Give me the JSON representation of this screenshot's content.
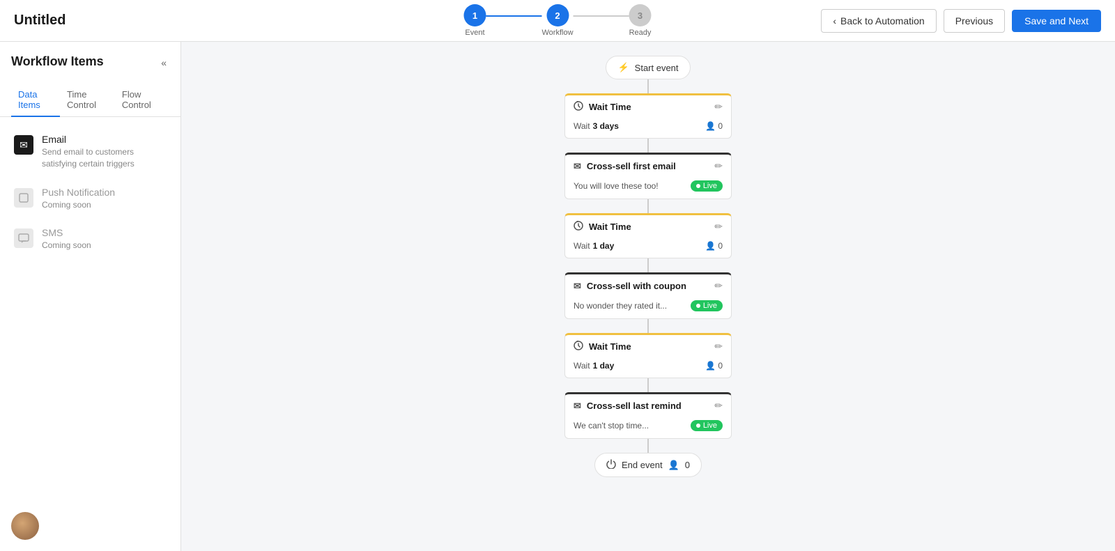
{
  "header": {
    "title": "Untitled",
    "back_button": "Back to Automation",
    "prev_button": "Previous",
    "save_button": "Save and Next"
  },
  "stepper": {
    "steps": [
      {
        "number": "1",
        "label": "Event",
        "state": "active"
      },
      {
        "number": "2",
        "label": "Workflow",
        "state": "active"
      },
      {
        "number": "3",
        "label": "Ready",
        "state": "inactive"
      }
    ]
  },
  "sidebar": {
    "title": "Workflow Items",
    "collapse_icon": "«",
    "tabs": [
      {
        "label": "Data Items",
        "active": true
      },
      {
        "label": "Time Control",
        "active": false
      },
      {
        "label": "Flow Control",
        "active": false
      }
    ],
    "items": [
      {
        "name": "Email",
        "desc": "Send email to customers satisfying certain triggers",
        "icon_type": "email",
        "icon_char": "✉",
        "muted": false
      },
      {
        "name": "Push Notification",
        "desc": "Coming soon",
        "icon_type": "push",
        "icon_char": "□",
        "muted": true
      },
      {
        "name": "SMS",
        "desc": "Coming soon",
        "icon_type": "sms",
        "icon_char": "💬",
        "muted": true
      }
    ]
  },
  "workflow": {
    "start_label": "Start event",
    "start_icon": "⚡",
    "end_label": "End event",
    "end_icon": "⏻",
    "end_count": "0",
    "nodes": [
      {
        "type": "wait",
        "title": "Wait Time",
        "icon": "🔄",
        "body_prefix": "Wait",
        "body_value": "3 days",
        "count": "0",
        "show_count": true,
        "show_status": false,
        "status_label": ""
      },
      {
        "type": "email",
        "title": "Cross-sell first email",
        "icon": "✉",
        "body_prefix": "",
        "body_value": "You will love these too!",
        "count": "",
        "show_count": false,
        "show_status": true,
        "status_label": "Live"
      },
      {
        "type": "wait",
        "title": "Wait Time",
        "icon": "🔄",
        "body_prefix": "Wait",
        "body_value": "1 day",
        "count": "0",
        "show_count": true,
        "show_status": false,
        "status_label": ""
      },
      {
        "type": "email",
        "title": "Cross-sell with coupon",
        "icon": "✉",
        "body_prefix": "",
        "body_value": "No wonder they rated it...",
        "count": "",
        "show_count": false,
        "show_status": true,
        "status_label": "Live"
      },
      {
        "type": "wait",
        "title": "Wait Time",
        "icon": "🔄",
        "body_prefix": "Wait",
        "body_value": "1 day",
        "count": "0",
        "show_count": true,
        "show_status": false,
        "status_label": ""
      },
      {
        "type": "email",
        "title": "Cross-sell last remind",
        "icon": "✉",
        "body_prefix": "",
        "body_value": "We can't stop time...",
        "count": "",
        "show_count": false,
        "show_status": true,
        "status_label": "Live"
      }
    ]
  }
}
